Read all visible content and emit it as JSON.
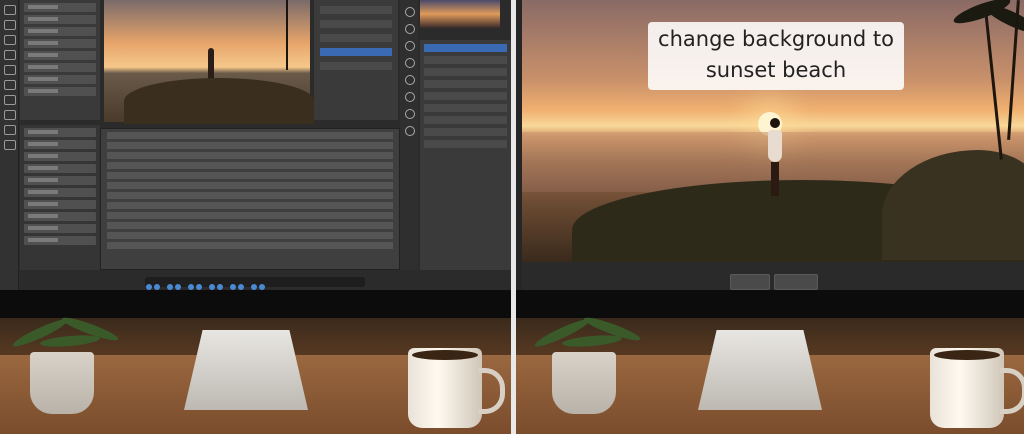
{
  "caption": {
    "text": "change background to sunset beach"
  },
  "editor": {
    "buttons": [
      "",
      ""
    ]
  },
  "icons": {
    "tools": [
      "move-icon",
      "marquee-icon",
      "lasso-icon",
      "wand-icon",
      "crop-icon",
      "brush-icon",
      "eraser-icon",
      "type-icon",
      "hand-icon",
      "zoom-icon"
    ],
    "panel": [
      "history-icon",
      "brush-settings-icon",
      "properties-icon",
      "adjustments-icon",
      "layers-icon",
      "channels-icon"
    ]
  }
}
